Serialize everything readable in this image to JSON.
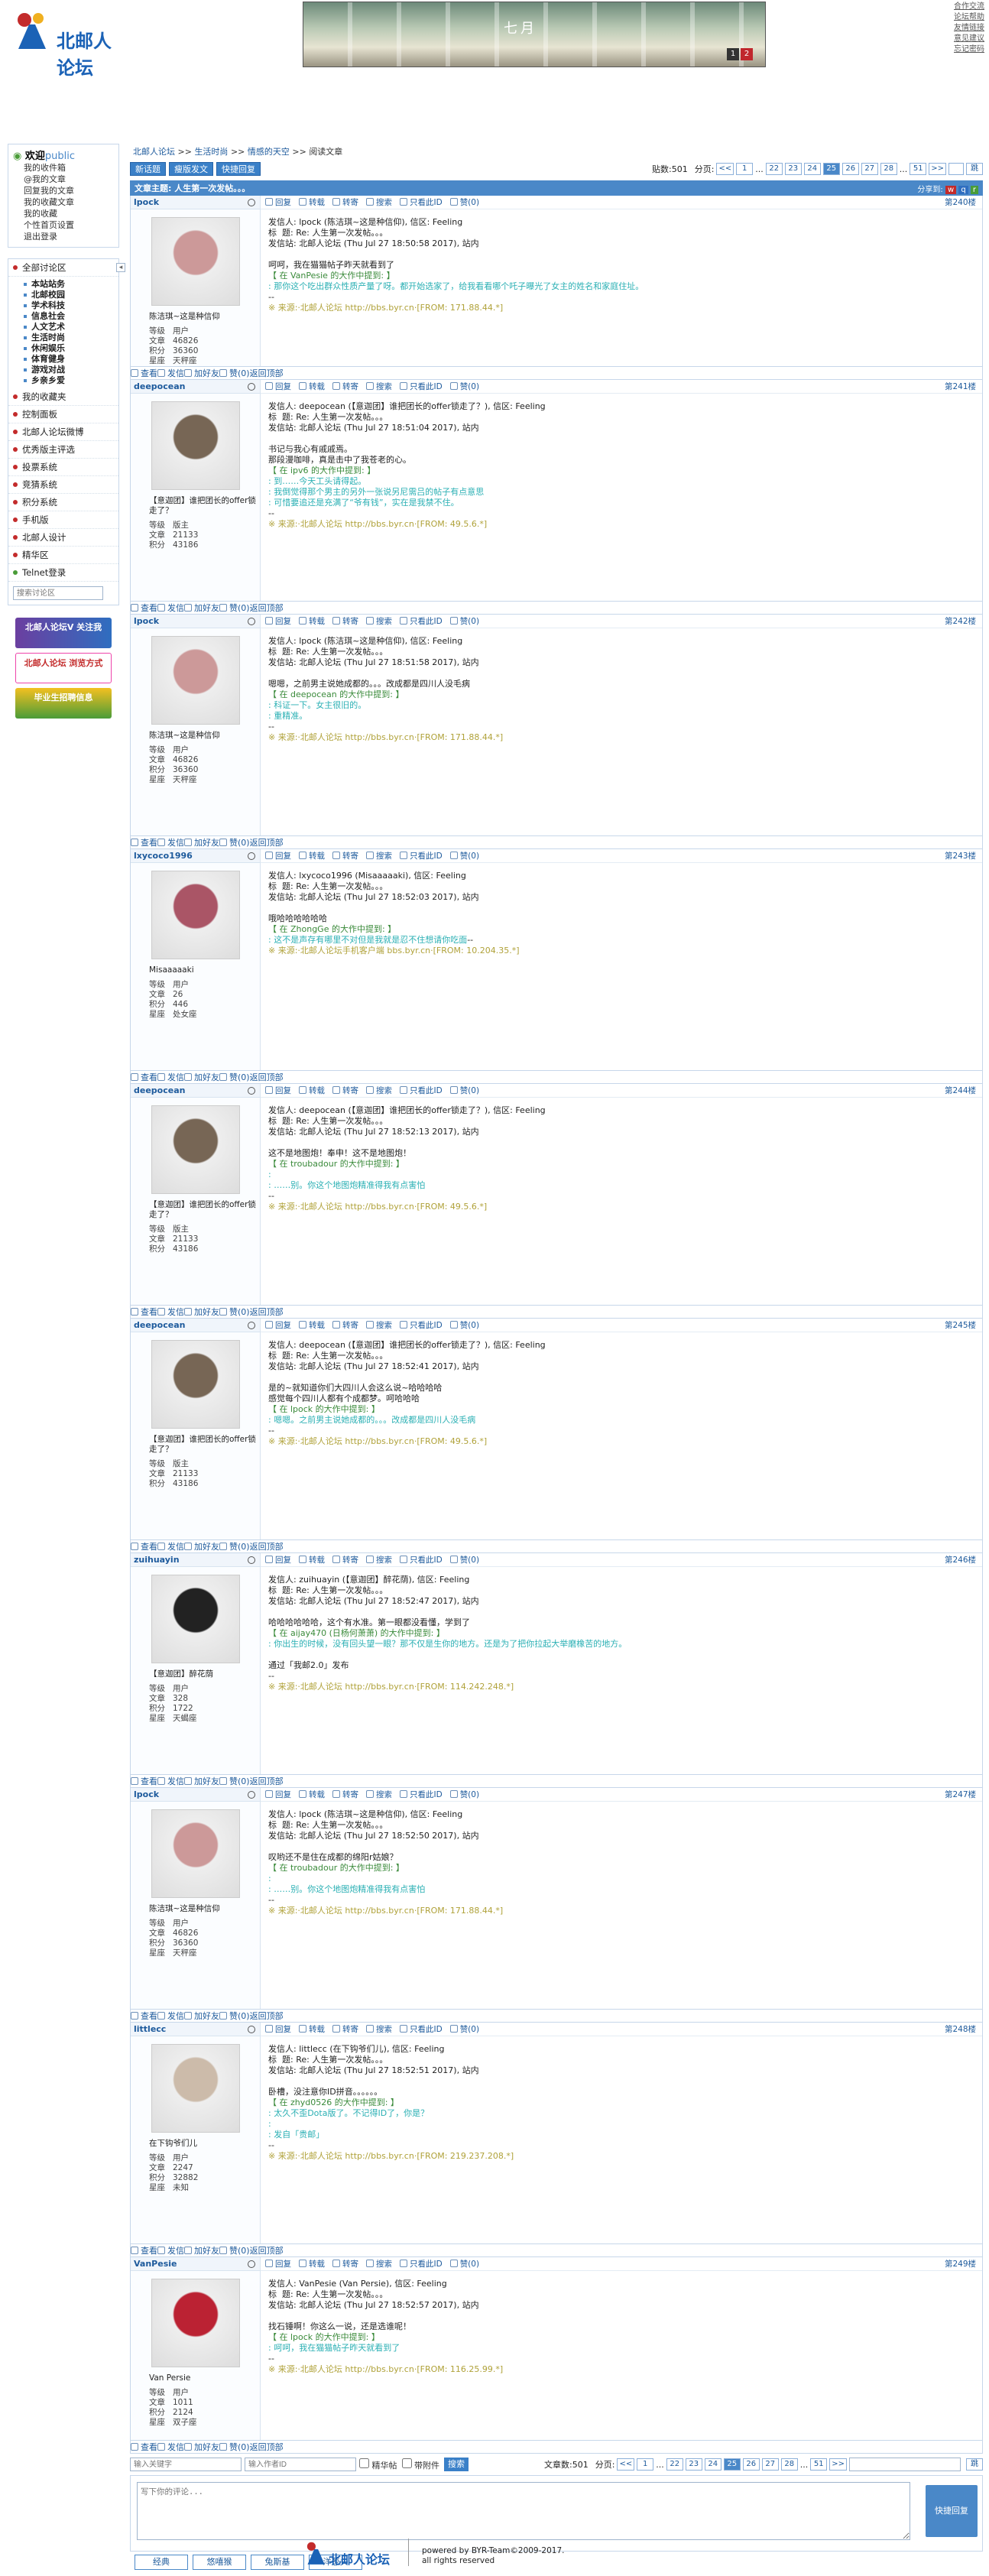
{
  "header": {
    "logo_text": "北邮人论坛",
    "banner_title": "七月",
    "banner_pages": [
      "1",
      "2"
    ],
    "links": [
      "合作交流",
      "论坛帮助",
      "友情链接",
      "意见建议",
      "忘记密码"
    ]
  },
  "sidebar": {
    "welcome": "欢迎",
    "user": "public",
    "user_links": [
      "我的收件箱",
      "@我的文章",
      "回复我的文章",
      "我的收藏文章",
      "我的收藏",
      "个性首页设置",
      "退出登录"
    ],
    "all_sections": "全部讨论区",
    "subs": [
      "本站站务",
      "北邮校园",
      "学术科技",
      "信息社会",
      "人文艺术",
      "生活时尚",
      "休闲娱乐",
      "体育健身",
      "游戏对战",
      "乡亲乡爱"
    ],
    "items": [
      "我的收藏夹",
      "控制面板",
      "北邮人论坛微博",
      "优秀版主评选",
      "投票系统",
      "竞猜系统",
      "积分系统",
      "手机版",
      "北邮人设计",
      "精华区",
      "Telnet登录"
    ],
    "search_placeholder": "搜索讨论区",
    "promos": [
      "北邮人论坛V 关注我",
      "北邮人论坛 浏览方式",
      "毕业生招聘信息"
    ]
  },
  "breadcrumb": [
    "北邮人论坛",
    ">>",
    "生活时尚",
    ">>",
    "情感的天空",
    ">>",
    "阅读文章"
  ],
  "toolbar": {
    "new": "新话题",
    "mod": "瘦版发文",
    "quick": "快捷回复",
    "count": "贴数:501",
    "pages_label": "分页:",
    "go": "跳"
  },
  "pager": [
    "<<",
    "1",
    "...",
    "22",
    "23",
    "24",
    "25",
    "26",
    "27",
    "28",
    "...",
    "51",
    ">>"
  ],
  "article_title": "文章主题: 人生第一次发帖。。。",
  "share": "分享到:",
  "ops": [
    "回复",
    "转载",
    "转寄",
    "搜索",
    "只看此ID",
    "赞(0)"
  ],
  "foot_ops": [
    "查看",
    "发信",
    "加好友"
  ],
  "back_top": "返回顶部",
  "labels": {
    "level": "等级",
    "posts": "文章",
    "score": "积分",
    "star": "星座"
  },
  "posts": [
    {
      "id": "lpock",
      "nick": "陈洁琪~这是种信仰",
      "level": "用户",
      "posts": "46826",
      "score": "36360",
      "star": "天秤座",
      "floor": "第240楼",
      "head": "发信人: lpock (陈洁琪~这是种信仰), 信区: Feeling\n标  题: Re: 人生第一次发帖。。。\n发信站: 北邮人论坛 (Thu Jul 27 18:50:58 2017), 站内\n\n呵呵，我在猫猫帖子昨天就看到了\n",
      "quote": "【 在 VanPesie 的大作中提到: 】",
      "qc": ": 那你这个吃出群众性质产量了呀。都开始选家了，给我看看哪个吒子曝光了女主的姓名和家庭住址。",
      "tail": "\n--\n",
      "src": "※ 来源:·北邮人论坛 http://bbs.byr.cn·[FROM: 171.88.44.*]",
      "pc": "#c99"
    },
    {
      "id": "deepocean",
      "nick": "【意迦团】谁把团长的offer锁走了？",
      "level": "版主",
      "posts": "21133",
      "score": "43186",
      "star": "",
      "floor": "第241楼",
      "head": "发信人: deepocean (【意迦团】谁把团长的offer锁走了？), 信区: Feeling\n标  题: Re: 人生第一次发帖。。。\n发信站: 北邮人论坛 (Thu Jul 27 18:51:04 2017), 站内\n\n书记与我心有戚戚焉。\n那段漫咖啡，真是击中了我苍老的心。\n",
      "quote": "【 在 ipv6 的大作中提到: 】",
      "qc": ": 到……今天工头请得起。\n: 我倒觉得那个男主的另外一张说另尼需吕的帖子有点意思\n: 可惜要追还是充满了“爷有钱”，实在是我禁不住。",
      "tail": "\n--\n",
      "src": "※ 来源:·北邮人论坛 http://bbs.byr.cn·[FROM: 49.5.6.*]",
      "pc": "#765"
    },
    {
      "id": "lpock",
      "nick": "陈洁琪~这是种信仰",
      "level": "用户",
      "posts": "46826",
      "score": "36360",
      "star": "天秤座",
      "floor": "第242楼",
      "head": "发信人: lpock (陈洁琪~这是种信仰), 信区: Feeling\n标  题: Re: 人生第一次发帖。。。\n发信站: 北邮人论坛 (Thu Jul 27 18:51:58 2017), 站内\n\n嗯嗯，之前男主说她成都的。。。改成都是四川人没毛病\n",
      "quote": "【 在 deepocean 的大作中提到: 】",
      "qc": ": 科证一下。女主很旧的。\n: 重精准。",
      "tail": "\n--\n",
      "src": "※ 来源:·北邮人论坛 http://bbs.byr.cn·[FROM: 171.88.44.*]",
      "pc": "#c99"
    },
    {
      "id": "lxycoco1996",
      "nick": "Misaaaaaki",
      "level": "用户",
      "posts": "26",
      "score": "446",
      "star": "处女座",
      "floor": "第243楼",
      "head": "发信人: lxycoco1996 (Misaaaaaki), 信区: Feeling\n标  题: Re: 人生第一次发帖。。。\n发信站: 北邮人论坛 (Thu Jul 27 18:52:03 2017), 站内\n\n哦哈哈哈哈哈哈\n",
      "quote": "【 在 ZhongGe 的大作中提到: 】",
      "qc": ": 这不是声存有哪里不对但是我就是忍不住想请你吃面",
      "tail": "--\n",
      "src": "※ 来源:·北邮人论坛手机客户端 bbs.byr.cn·[FROM: 10.204.35.*]",
      "pc": "#a56"
    },
    {
      "id": "deepocean",
      "nick": "【意迦团】谁把团长的offer锁走了？",
      "level": "版主",
      "posts": "21133",
      "score": "43186",
      "star": "",
      "floor": "第244楼",
      "head": "发信人: deepocean (【意迦团】谁把团长的offer锁走了？), 信区: Feeling\n标  题: Re: 人生第一次发帖。。。\n发信站: 北邮人论坛 (Thu Jul 27 18:52:13 2017), 站内\n\n这不是地图炮！奉申！这不是地图炮！\n",
      "quote": "【 在 troubadour 的大作中提到: 】",
      "qc": ":\n: ……别。你这个地图炮精准得我有点害怕",
      "tail": "\n--\n",
      "src": "※ 来源:·北邮人论坛 http://bbs.byr.cn·[FROM: 49.5.6.*]",
      "pc": "#765"
    },
    {
      "id": "deepocean",
      "nick": "【意迦团】谁把团长的offer锁走了？",
      "level": "版主",
      "posts": "21133",
      "score": "43186",
      "star": "",
      "floor": "第245楼",
      "head": "发信人: deepocean (【意迦团】谁把团长的offer锁走了？), 信区: Feeling\n标  题: Re: 人生第一次发帖。。。\n发信站: 北邮人论坛 (Thu Jul 27 18:52:41 2017), 站内\n\n是的~就知道你们大四川人会这么说~哈哈哈哈\n感觉每个四川人都有个成都梦。呵哈哈哈\n",
      "quote": "【 在 lpock 的大作中提到: 】",
      "qc": ": 嗯嗯。之前男主说她成都的。。。改成都是四川人没毛病",
      "tail": "\n--\n",
      "src": "※ 来源:·北邮人论坛 http://bbs.byr.cn·[FROM: 49.5.6.*]",
      "pc": "#765"
    },
    {
      "id": "zuihuayin",
      "nick": "【意迦团】醉花荫",
      "level": "用户",
      "posts": "328",
      "score": "1722",
      "star": "天蝎座",
      "floor": "第246楼",
      "head": "发信人: zuihuayin (【意迦团】醉花荫), 信区: Feeling\n标  题: Re: 人生第一次发帖。。。\n发信站: 北邮人论坛 (Thu Jul 27 18:52:47 2017), 站内\n\n哈哈哈哈哈哈，这个有水准。第一眼都没看懂，学到了\n",
      "quote": "【 在 aijay470 (日杨何萧萧) 的大作中提到: 】",
      "qc": ": 你出生的时候，没有回头望一眼？那不仅是生你的地方。还是为了把你拉起大举磨橡苦的地方。",
      "tail": "\n\n通过「我邮2.0」发布\n--\n",
      "src": "※ 来源:·北邮人论坛 http://bbs.byr.cn·[FROM: 114.242.248.*]",
      "pc": "#222"
    },
    {
      "id": "lpock",
      "nick": "陈洁琪~这是种信仰",
      "level": "用户",
      "posts": "46826",
      "score": "36360",
      "star": "天秤座",
      "floor": "第247楼",
      "head": "发信人: lpock (陈洁琪~这是种信仰), 信区: Feeling\n标  题: Re: 人生第一次发帖。。。\n发信站: 北邮人论坛 (Thu Jul 27 18:52:50 2017), 站内\n\n叹哟还不是住在成都的绵阳r姑娘？\n",
      "quote": "【 在 troubadour 的大作中提到: 】",
      "qc": ":\n: ……别。你这个地图炮精准得我有点害怕",
      "tail": "\n--\n",
      "src": "※ 来源:·北邮人论坛 http://bbs.byr.cn·[FROM: 171.88.44.*]",
      "pc": "#c99"
    },
    {
      "id": "littlecc",
      "nick": "在下钩爷们儿",
      "level": "用户",
      "posts": "2247",
      "score": "32882",
      "star": "未知",
      "floor": "第248楼",
      "head": "发信人: littlecc (在下钩爷们儿), 信区: Feeling\n标  题: Re: 人生第一次发帖。。。\n发信站: 北邮人论坛 (Thu Jul 27 18:52:51 2017), 站内\n\n卧槽，没注意你ID拼音。。。。。。\n",
      "quote": "【 在 zhyd0526 的大作中提到: 】",
      "qc": ": 太久不歪Dota版了。不记得ID了，你是？\n:\n: 发自「贵邮」",
      "tail": "\n--\n",
      "src": "※ 来源:·北邮人论坛 http://bbs.byr.cn·[FROM: 219.237.208.*]",
      "pc": "#cba"
    },
    {
      "id": "VanPesie",
      "nick": "Van Persie",
      "level": "用户",
      "posts": "1011",
      "score": "2124",
      "star": "双子座",
      "floor": "第249楼",
      "head": "发信人: VanPesie (Van Persie), 信区: Feeling\n标  题: Re: 人生第一次发帖。。。\n发信站: 北邮人论坛 (Thu Jul 27 18:52:57 2017), 站内\n\n找石锤啊！你这么一说，还是选谁呢！\n",
      "quote": "【 在 lpock 的大作中提到: 】",
      "qc": ": 呵呵，我在猫猫帖子昨天就看到了",
      "tail": "\n--\n",
      "src": "※ 来源:·北邮人论坛 http://bbs.byr.cn·[FROM: 116.25.99.*]",
      "pc": "#b23"
    }
  ],
  "bottom": {
    "kw_placeholder": "输入关键字",
    "author_placeholder": "输入作者ID",
    "digest": "精华帖",
    "attach": "带附件",
    "search": "搜索",
    "count": "文章数:501",
    "pages_label": "分页:"
  },
  "reply": {
    "placeholder": "写下你的评论...",
    "button": "快捷回复",
    "emos": [
      "经典",
      "悠嘻猴",
      "兔斯基",
      "洋葱头"
    ]
  },
  "footer": {
    "logo": "北邮人论坛",
    "line1": "powered by BYR-Team©2009-2017.",
    "line2": "all rights reserved"
  },
  "colors": {
    "accent": "#4a88c8",
    "brand": "#1b62b6"
  }
}
